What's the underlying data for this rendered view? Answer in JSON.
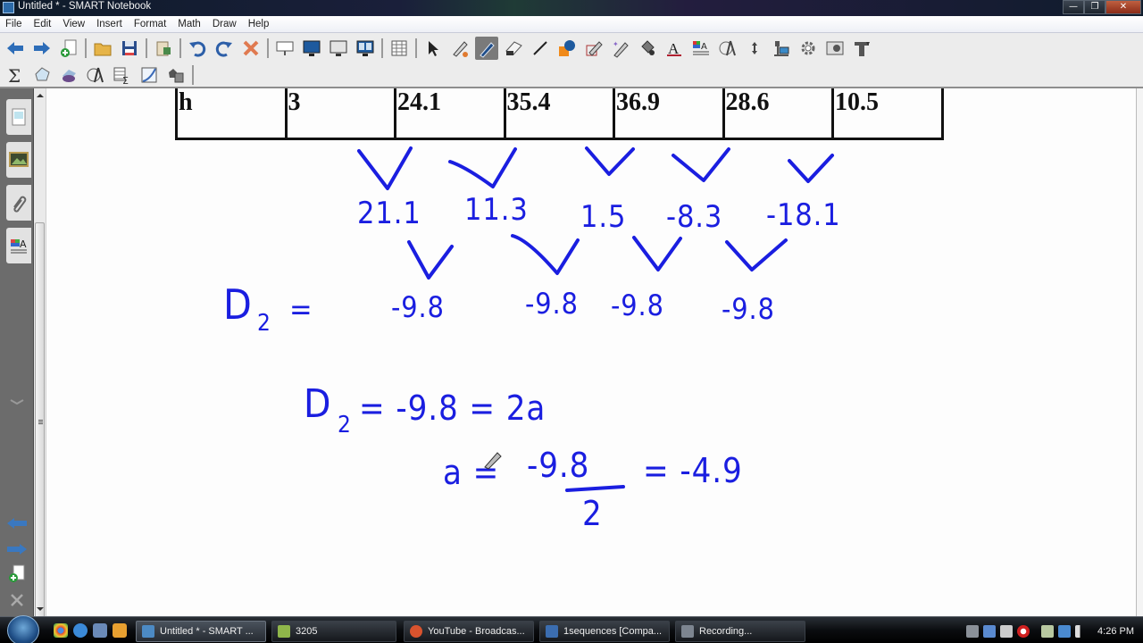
{
  "window": {
    "title": "Untitled * - SMART Notebook",
    "controls": {
      "minimize": "—",
      "restore": "❐",
      "close": "✕"
    }
  },
  "menu": [
    "File",
    "Edit",
    "View",
    "Insert",
    "Format",
    "Math",
    "Draw",
    "Help"
  ],
  "toolbar": {
    "row1": [
      "back-arrow",
      "forward-arrow",
      "new-page",
      "sep",
      "open-folder",
      "save",
      "sep",
      "paste",
      "sep",
      "undo",
      "redo",
      "delete",
      "sep",
      "screen-shade",
      "full-screen",
      "transparent-background",
      "dual-page",
      "sep",
      "insert-table",
      "sep",
      "select",
      "creative-pen",
      "pen",
      "eraser",
      "line",
      "shapes",
      "magic-pen-regular",
      "magic-pen",
      "fill",
      "text",
      "properties",
      "measurement-tools",
      "move-toolbar",
      "document-camera",
      "customize",
      "screen-capture",
      "toolbar-extra"
    ],
    "row2": [
      "sigma",
      "shape-recognition",
      "3d-shapes",
      "geometry-tools",
      "table-sum",
      "graph",
      "addons",
      "sep"
    ],
    "active_tool": "pen"
  },
  "side_tabs": [
    "page-sorter",
    "gallery",
    "attachments",
    "properties"
  ],
  "side_nav": [
    "previous-page",
    "next-page",
    "add-page",
    "delete-page"
  ],
  "table": {
    "cells": [
      "h",
      "3",
      "24.1",
      "35.4",
      "36.9",
      "28.6",
      "10.5"
    ]
  },
  "handwriting": {
    "first_differences": [
      "21.1",
      "11.3",
      "1.5",
      "-8.3",
      "-18.1"
    ],
    "second_differences_label": "D",
    "second_differences_sub": "2",
    "equals": "=",
    "second_differences": [
      "-9.8",
      "-9.8",
      "-9.8",
      "-9.8"
    ],
    "equation1": {
      "lhs": "D",
      "sub": "2",
      "rest": "= -9.8 = 2a"
    },
    "equation2": {
      "lhs": "a =",
      "numerator": "-9.8",
      "denominator": "2",
      "result": "= -4.9"
    }
  },
  "taskbar": {
    "tasks": [
      {
        "label": "Untitled * - SMART ...",
        "active": true,
        "color": "#4c8ac4"
      },
      {
        "label": "3205",
        "active": false,
        "color": "#8fb64a"
      },
      {
        "label": "YouTube - Broadcas...",
        "active": false,
        "color": "#d9532e"
      },
      {
        "label": "1sequences [Compa...",
        "active": false,
        "color": "#3b6db0"
      },
      {
        "label": "Recording...",
        "active": false,
        "color": "#7d8590"
      }
    ],
    "clock": "4:26 PM"
  },
  "colors": {
    "ink": "#1a1ee0",
    "active_tool_bg": "#7a7a7a"
  }
}
